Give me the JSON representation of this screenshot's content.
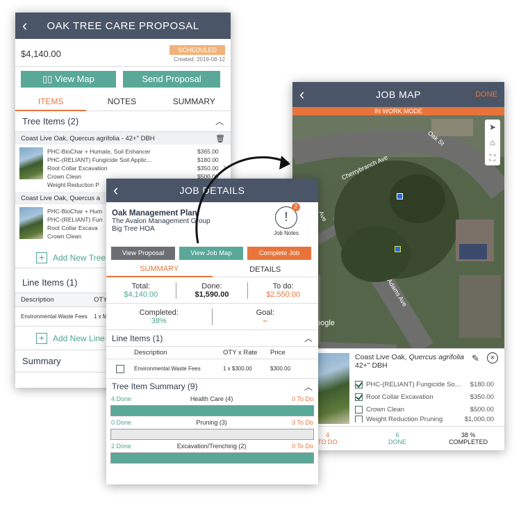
{
  "proposal": {
    "title": "OAK TREE CARE PROPOSAL",
    "total": "$4,140.00",
    "status_badge": "SCHEDULED",
    "created": "Created: 2019-08-12",
    "view_map": "View Map",
    "send_proposal": "Send Proposal",
    "tabs": [
      "ITEMS",
      "NOTES",
      "SUMMARY"
    ],
    "tree_items_header": "Tree Items (2)",
    "tree1": {
      "name": "Coast Live Oak, Quercus agrifolia - 42+\" DBH",
      "services": [
        {
          "name": "PHC-BioChar + Humate, Soil Enhancer",
          "price": "$365.00"
        },
        {
          "name": "PHC-(RELIANT) Fungicide Soil Applic...",
          "price": "$180.00"
        },
        {
          "name": "Root Collar Excavation",
          "price": "$350.00"
        },
        {
          "name": "Crown Clean",
          "price": "$500.00"
        },
        {
          "name": "Weight Reduction P",
          "price": ""
        }
      ]
    },
    "tree2": {
      "name": "Coast Live Oak, Quercus a",
      "services": [
        {
          "name": "PHC-BioChar + Hum",
          "price": ""
        },
        {
          "name": "PHC-(RELIANT) Fun",
          "price": ""
        },
        {
          "name": "Root Collar Excava",
          "price": ""
        },
        {
          "name": "Crown Clean",
          "price": ""
        }
      ]
    },
    "add_tree": "Add New Tree",
    "line_items_header": "Line Items (1)",
    "col_description": "Description",
    "col_qty": "OTY",
    "line1_desc": "Environmental Waste Fees",
    "line1_qty": "1 x M",
    "add_line": "Add New Line",
    "summary": "Summary"
  },
  "job_details": {
    "title": "JOB DETAILS",
    "plan": "Oak Management Plan",
    "company": "The Avalon Management Group",
    "client": "Big Tree HOA",
    "notes_label": "Job Notes",
    "notes_count": "2",
    "view_proposal": "View Proposal",
    "view_job_map": "View Job Map",
    "complete_job": "Complete Job",
    "tabs": [
      "SUMMARY",
      "DETAILS"
    ],
    "total_label": "Total:",
    "total": "$4,140.00",
    "done_label": "Done:",
    "done": "$1,590.00",
    "todo_label": "To do:",
    "todo": "$2,550.00",
    "completed_label": "Completed:",
    "completed": "38%",
    "goal_label": "Goal:",
    "goal": "–",
    "line_items_header": "Line Items (1)",
    "col_description": "Description",
    "col_qty": "OTY x Rate",
    "col_price": "Price",
    "line1_desc": "Environmental Waste Fees",
    "line1_qty": "1 x $300.00",
    "line1_price": "$300.00",
    "tree_summary_header": "Tree Item Summary (9)",
    "summary_rows": [
      {
        "done": "4 Done",
        "name": "Health Care (4)",
        "todo": "0 To Do",
        "progress": 1.0
      },
      {
        "done": "0 Done",
        "name": "Pruning (3)",
        "todo": "3 To Do",
        "progress": 0.0
      },
      {
        "done": "2 Done",
        "name": "Excavation/Trenching (2)",
        "todo": "0 To Do",
        "progress": 1.0
      }
    ]
  },
  "job_map": {
    "title": "JOB MAP",
    "done": "DONE",
    "mode": "IN WORK MODE",
    "streets": [
      "Oak St",
      "Cherrybranch Ave",
      "Adams Ave",
      "Ave"
    ],
    "google": "oogle",
    "tree_name": "Coast Live Oak, ",
    "tree_latin": "Quercus agrifolia",
    "tree_dbh": "42+\" DBH",
    "services": [
      {
        "name": "PHC-(RELIANT) Fungicide So...",
        "price": "$180.00",
        "checked": true
      },
      {
        "name": "Root Collar Excavation",
        "price": "$350.00",
        "checked": true
      },
      {
        "name": "Crown Clean",
        "price": "$500.00",
        "checked": false
      },
      {
        "name": "Weight Reduction Pruning",
        "price": "$1,000.00",
        "checked": false
      }
    ],
    "stat_todo_n": "4",
    "stat_todo": "TO DO",
    "stat_done_n": "6",
    "stat_done": "DONE",
    "stat_pct": "38 %",
    "stat_completed": "COMPLETED"
  },
  "colors": {
    "nav": "#4a5568",
    "teal": "#5aa897",
    "orange": "#e8743b",
    "slate": "#6b6f73"
  }
}
